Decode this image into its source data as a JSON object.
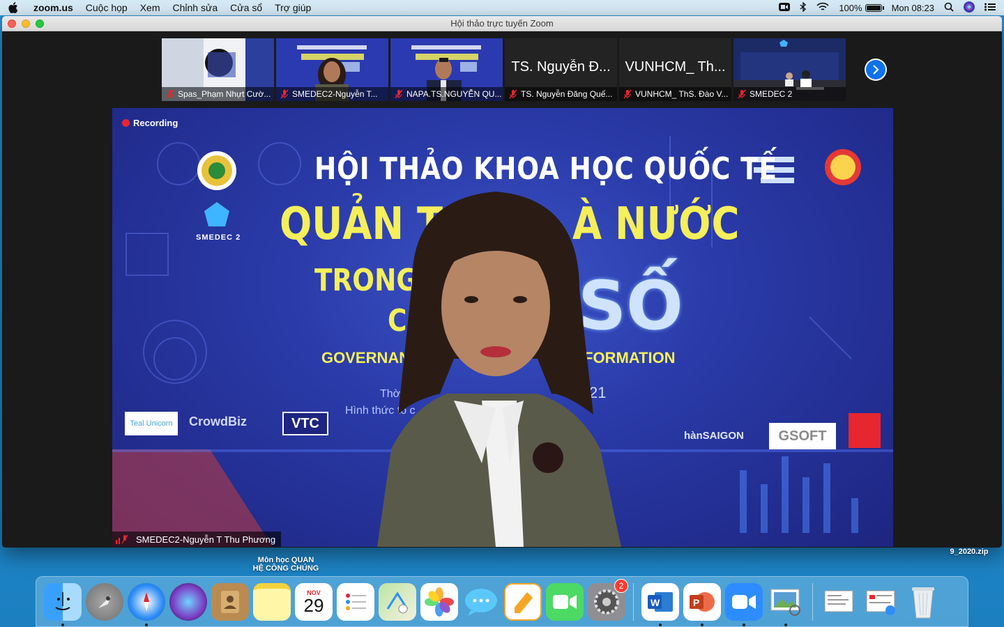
{
  "menubar": {
    "app_name": "zoom.us",
    "items": [
      "Cuộc họp",
      "Xem",
      "Chỉnh sửa",
      "Cửa sổ",
      "Trợ giúp"
    ],
    "battery_text": "100%",
    "battery_level": 1.0,
    "clock": "Mon 08:23"
  },
  "window": {
    "title": "Hội thảo trực tuyến Zoom"
  },
  "thumbnails": [
    {
      "name": "Spas_Phạm Nhựt Cườ...",
      "big_text": ""
    },
    {
      "name": "SMEDEC2-Nguyễn T...",
      "big_text": "",
      "active": true
    },
    {
      "name": "NAPA.TS.NGUYỄN QU...",
      "big_text": ""
    },
    {
      "name": "TS. Nguyễn Đăng Quế...",
      "big_text": "TS. Nguyễn Đ..."
    },
    {
      "name": "VUNHCM_ ThS. Đào V...",
      "big_text": "VUNHCM_ Th..."
    },
    {
      "name": "SMEDEC 2",
      "big_text": ""
    }
  ],
  "main_video": {
    "recording_label": "Recording",
    "speaker_name": "SMEDEC2-Nguyễn T Thu Phương",
    "banner": {
      "line1": "HỘI THẢO KHOA HỌC QUỐC TẾ",
      "line2_left": "QUẢN T",
      "line2_right": "À NƯỚC",
      "line3": "TRONG",
      "line4": "CH",
      "so": "SỐ",
      "gov": "GOVERNANC",
      "form": "FORMATION",
      "time": "Thời gia",
      "form_label": "Hình thức tổ c",
      "year": "21",
      "logo_smedec": "SMEDEC 2",
      "logo_vtc": "VTC",
      "logo_crowd": "CrowdBiz",
      "logo_teal": "Teal Unicorn",
      "logo_gsoft": "GSOFT",
      "logo_saigon": "hànSAIGON"
    }
  },
  "desktop": {
    "file_label_1": "Môn học QUAN\nHỆ CÔNG CHÚNG",
    "file_label_2": "9_2020.zip"
  },
  "dock": {
    "apps": [
      "Finder",
      "Launchpad",
      "Safari",
      "Siri",
      "Contacts",
      "Notes",
      "Calendar",
      "Reminders",
      "Maps",
      "Photos",
      "Messages",
      "Pages",
      "FaceTime",
      "System Preferences",
      "Word",
      "PowerPoint",
      "Zoom",
      "Preview"
    ],
    "calendar_month": "NOV",
    "calendar_day": "29",
    "sysprefs_badge": "2"
  }
}
